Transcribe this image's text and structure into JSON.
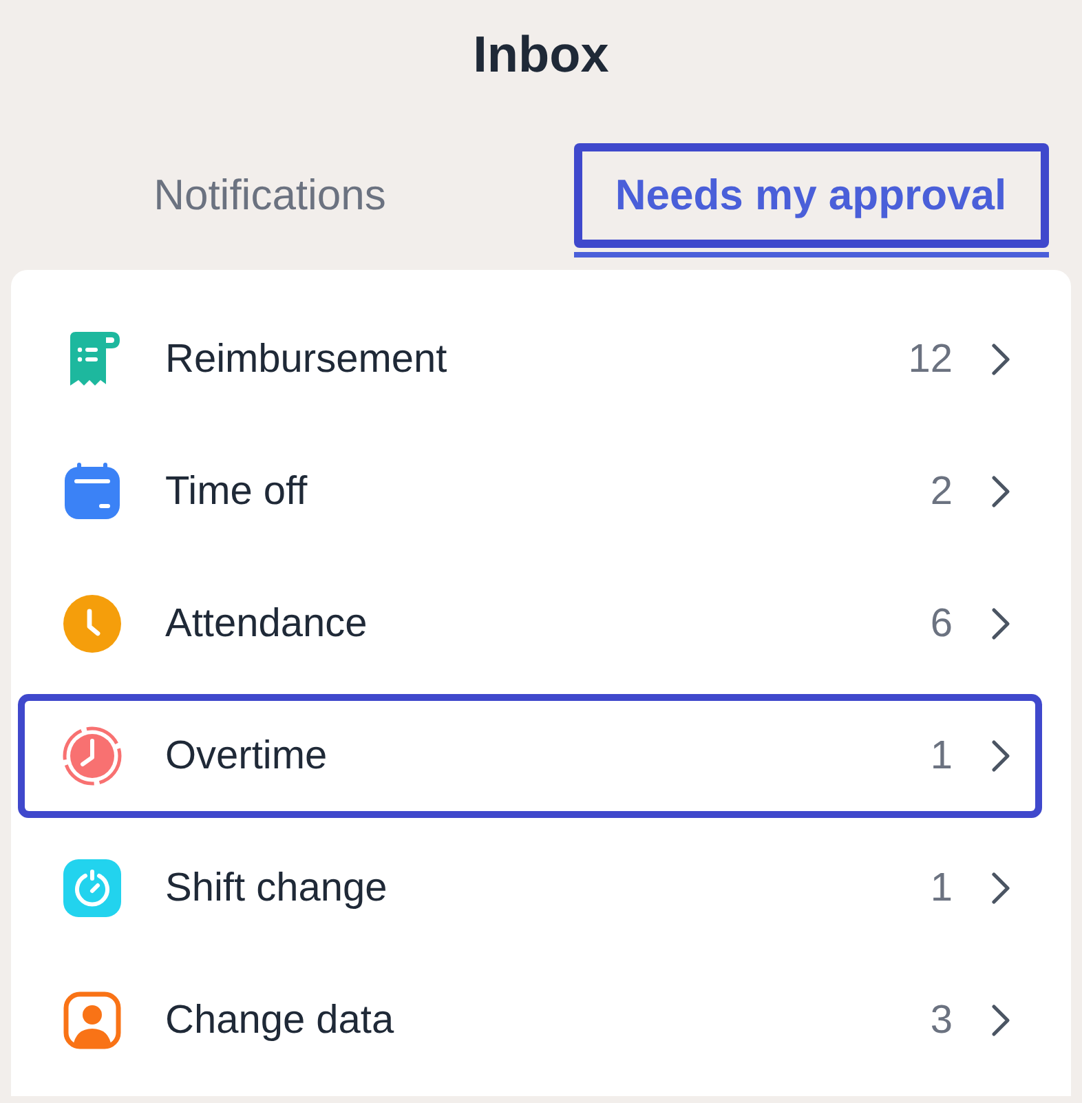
{
  "title": "Inbox",
  "tabs": [
    {
      "label": "Notifications",
      "selected": false,
      "highlighted": false
    },
    {
      "label": "Needs my approval",
      "selected": true,
      "highlighted": true
    }
  ],
  "items": [
    {
      "kind": "receipt",
      "color": "#1db89e",
      "label": "Reimbursement",
      "count": "12",
      "highlighted": false
    },
    {
      "kind": "calendar",
      "color": "#3b82f6",
      "label": "Time off",
      "count": "2",
      "highlighted": false
    },
    {
      "kind": "clock",
      "color": "#f59e0b",
      "label": "Attendance",
      "count": "6",
      "highlighted": false
    },
    {
      "kind": "overtime",
      "color": "#f87171",
      "label": "Overtime",
      "count": "1",
      "highlighted": true
    },
    {
      "kind": "shift",
      "color": "#22d3ee",
      "label": "Shift change",
      "count": "1",
      "highlighted": false
    },
    {
      "kind": "person",
      "color": "#f97316",
      "label": "Change data",
      "count": "3",
      "highlighted": false
    }
  ]
}
